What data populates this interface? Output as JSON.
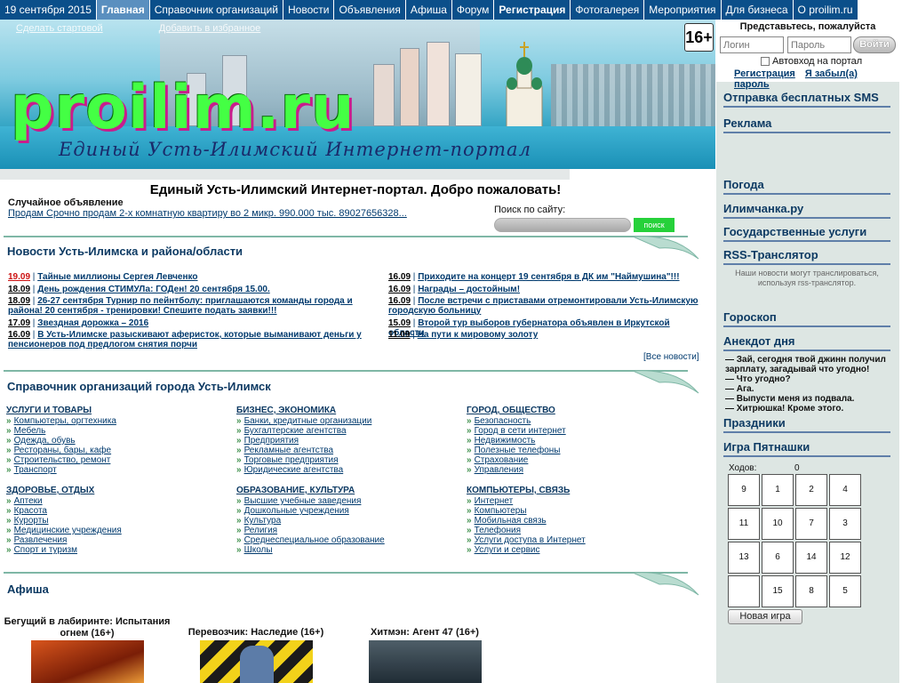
{
  "nav": {
    "date": "19 сентября 2015",
    "tabs": [
      "Главная",
      "Справочник организаций",
      "Новости",
      "Объявления",
      "Афиша",
      "Форум",
      "Регистрация",
      "Фотогалерея",
      "Мероприятия",
      "Для бизнеса",
      "О proilim.ru"
    ]
  },
  "banner": {
    "logo": "proilim.ru",
    "slogan": "Единый Усть-Илимский Интернет-портал",
    "start_link": "Сделать стартовой",
    "fav_link": "Добавить в избранное",
    "age": "16+"
  },
  "login": {
    "title": "Представьтесь, пожалуйста",
    "login_placeholder": "Логин",
    "password_placeholder": "Пароль",
    "submit": "Войти",
    "auto": "Автовход на портал",
    "register": "Регистрация",
    "forgot": "Я забыл(а) пароль"
  },
  "sidebar": {
    "sms": "Отправка бесплатных SMS",
    "ads": "Реклама",
    "weather": "Погода",
    "ilimchanka": "Илимчанка.ру",
    "gov": "Государственные услуги",
    "rss": "RSS-Транслятор",
    "rss_note": "Наши новости могут транслироваться, используя rss-транслятор.",
    "horoscope": "Гороскоп",
    "anecdote": "Анекдот дня",
    "anecdote_lines": [
      "— Зай, сегодня твой джинн получил зарплату, загадывай что угодно!",
      "— Что угодно?",
      "— Ага.",
      "— Выпусти меня из подвала.",
      "— Хитрюшка! Кроме этого."
    ],
    "holidays": "Праздники",
    "game": "Игра Пятнашки",
    "moves_label": "Ходов:",
    "moves": "0",
    "tiles": [
      "9",
      "1",
      "2",
      "4",
      "11",
      "10",
      "7",
      "3",
      "13",
      "6",
      "14",
      "12",
      "",
      "15",
      "8",
      "5"
    ],
    "new_game": "Новая игра"
  },
  "main": {
    "welcome": "Единый Усть-Илимский Интернет-портал. Добро пожаловать!",
    "random_title": "Случайное объявление",
    "random_text": "Продам Срочно продам 2-х комнатную квартиру во 2 микр. 990.000 тыс. 89027656328...",
    "search_label": "Поиск по сайту:",
    "search_button": "поиск",
    "news_title": "Новости Усть-Илимска и района/области",
    "news_left": [
      {
        "date": "19.09",
        "text": "Тайные миллионы Сергея Левченко"
      },
      {
        "date": "18.09",
        "text": "День рождения СТИМУЛа: ГОДен! 20 сентября 15.00."
      },
      {
        "date": "18.09",
        "text": "26-27 сентября Турнир по пейнтболу: приглашаются команды города и района! 20 сентября - тренировки! Спешите подать заявки!!!"
      },
      {
        "date": "17.09",
        "text": "Звездная дорожка – 2016"
      },
      {
        "date": "16.09",
        "text": "В Усть-Илимске разыскивают аферисток, которые выманивают деньги у пенсионеров под предлогом снятия порчи"
      }
    ],
    "news_right": [
      {
        "date": "16.09",
        "text": "Приходите на концерт 19 сентября в ДК им \"Наймушина\"!!!"
      },
      {
        "date": "16.09",
        "text": "Награды – достойным!"
      },
      {
        "date": "16.09",
        "text": "После встречи с приставами отремонтировали Усть-Илимскую городскую больницу"
      },
      {
        "date": "15.09",
        "text": "Второй тур выборов губернатора объявлен в Иркутской области"
      },
      {
        "date": "11.09",
        "text": "На пути к мировому золоту"
      }
    ],
    "all_news": "[Все новости]",
    "dir_title": "Справочник организаций города Усть-Илимск",
    "dir": [
      {
        "h": "УСЛУГИ И ТОВАРЫ",
        "items": [
          "Компьютеры, оргтехника",
          "Мебель",
          "Одежда, обувь",
          "Рестораны, бары, кафе",
          "Строительство, ремонт",
          "Транспорт"
        ]
      },
      {
        "h": "БИЗНЕС, ЭКОНОМИКА",
        "items": [
          "Банки, кредитные организации",
          "Бухгалтерские агентства",
          "Предприятия",
          "Рекламные агентства",
          "Торговые предприятия",
          "Юридические агентства"
        ]
      },
      {
        "h": "ГОРОД, ОБЩЕСТВО",
        "items": [
          "Безопасность",
          "Город в сети интернет",
          "Недвижимость",
          "Полезные телефоны",
          "Страхование",
          "Управления"
        ]
      },
      {
        "h": "ЗДОРОВЬЕ, ОТДЫХ",
        "items": [
          "Аптеки",
          "Красота",
          "Курорты",
          "Медицинские учреждения",
          "Развлечения",
          "Спорт и туризм"
        ]
      },
      {
        "h": "ОБРАЗОВАНИЕ, КУЛЬТУРА",
        "items": [
          "Высшие учебные заведения",
          "Дошкольные учреждения",
          "Культура",
          "Религия",
          "Среднеспециальное образование",
          "Школы"
        ]
      },
      {
        "h": "КОМПЬЮТЕРЫ, СВЯЗЬ",
        "items": [
          "Интернет",
          "Компьютеры",
          "Мобильная связь",
          "Телефония",
          "Услуги доступа в Интернет",
          "Услуги и сервис"
        ]
      }
    ],
    "afisha_title": "Афиша",
    "movies": [
      "Бегущий в лабиринте: Испытания огнем (16+)",
      "Перевозчик: Наследие (16+)",
      "Хитмэн: Агент 47 (16+)"
    ]
  }
}
